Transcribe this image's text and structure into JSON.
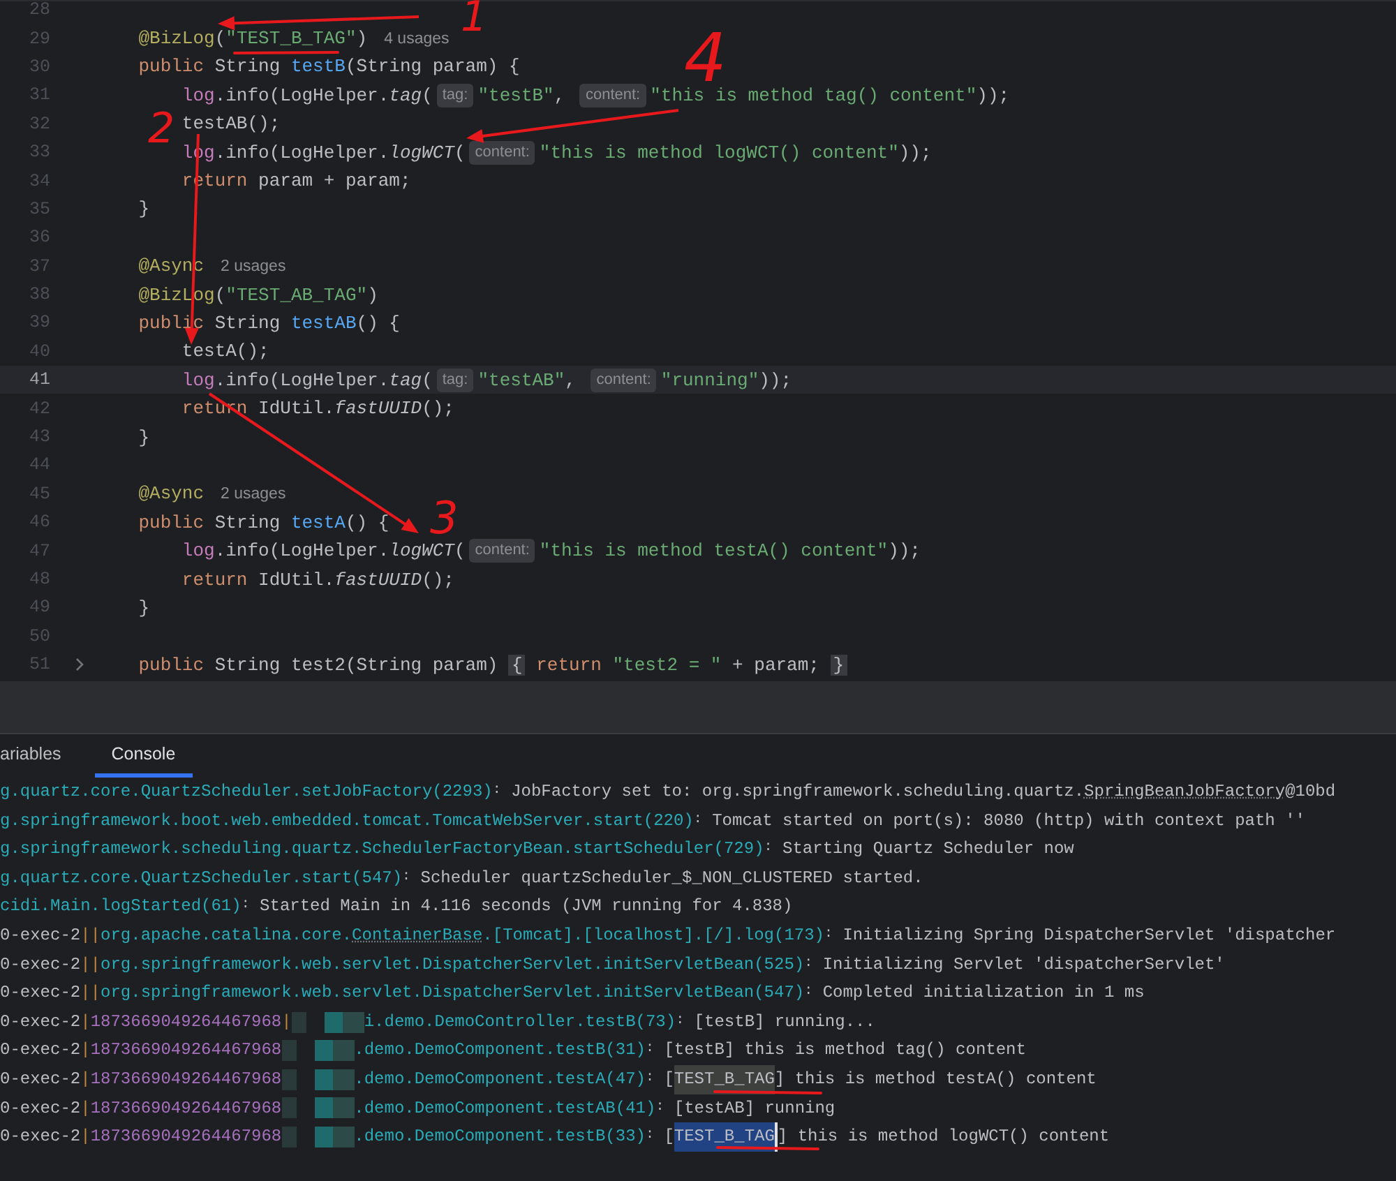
{
  "editor": {
    "lines": [
      {
        "number": "28",
        "current": false
      },
      {
        "number": "29",
        "current": false,
        "tokens": [
          {
            "kind": "ann",
            "text": "    @BizLog"
          },
          {
            "kind": "plain",
            "text": "("
          },
          {
            "kind": "str",
            "text": "\"TEST_B_TAG\""
          },
          {
            "kind": "plain",
            "text": ")"
          },
          {
            "kind": "usage",
            "text": "4 usages"
          }
        ]
      },
      {
        "number": "30",
        "current": false,
        "tokens": [
          {
            "kind": "kw",
            "text": "    public"
          },
          {
            "kind": "plain",
            "text": " String "
          },
          {
            "kind": "decl",
            "text": "testB"
          },
          {
            "kind": "plain",
            "text": "(String param) {"
          }
        ]
      },
      {
        "number": "31",
        "current": false,
        "tokens": [
          {
            "kind": "field",
            "text": "        log"
          },
          {
            "kind": "plain",
            "text": ".info(LogHelper."
          },
          {
            "kind": "ital",
            "text": "tag"
          },
          {
            "kind": "plain",
            "text": "("
          },
          {
            "kind": "hint",
            "text": "tag:"
          },
          {
            "kind": "str",
            "text": "\"testB\""
          },
          {
            "kind": "plain",
            "text": ", "
          },
          {
            "kind": "hint",
            "text": "content:"
          },
          {
            "kind": "str",
            "text": "\"this is method tag() content\""
          },
          {
            "kind": "plain",
            "text": "));"
          }
        ]
      },
      {
        "number": "32",
        "current": false,
        "tokens": [
          {
            "kind": "plain",
            "text": "        testAB();"
          }
        ]
      },
      {
        "number": "33",
        "current": false,
        "tokens": [
          {
            "kind": "field",
            "text": "        log"
          },
          {
            "kind": "plain",
            "text": ".info(LogHelper."
          },
          {
            "kind": "ital",
            "text": "logWCT"
          },
          {
            "kind": "plain",
            "text": "("
          },
          {
            "kind": "hint",
            "text": "content:"
          },
          {
            "kind": "str",
            "text": "\"this is method logWCT() content\""
          },
          {
            "kind": "plain",
            "text": "));"
          }
        ]
      },
      {
        "number": "34",
        "current": false,
        "tokens": [
          {
            "kind": "kw",
            "text": "        return"
          },
          {
            "kind": "plain",
            "text": " param + param;"
          }
        ]
      },
      {
        "number": "35",
        "current": false,
        "tokens": [
          {
            "kind": "plain",
            "text": "    }"
          }
        ]
      },
      {
        "number": "36",
        "current": false
      },
      {
        "number": "37",
        "current": false,
        "tokens": [
          {
            "kind": "ann",
            "text": "    @Async"
          },
          {
            "kind": "usage",
            "text": "2 usages"
          }
        ]
      },
      {
        "number": "38",
        "current": false,
        "tokens": [
          {
            "kind": "ann",
            "text": "    @BizLog"
          },
          {
            "kind": "plain",
            "text": "("
          },
          {
            "kind": "str",
            "text": "\"TEST_AB_TAG\""
          },
          {
            "kind": "plain",
            "text": ")"
          }
        ]
      },
      {
        "number": "39",
        "current": false,
        "tokens": [
          {
            "kind": "kw",
            "text": "    public"
          },
          {
            "kind": "plain",
            "text": " String "
          },
          {
            "kind": "decl",
            "text": "testAB"
          },
          {
            "kind": "plain",
            "text": "() {"
          }
        ]
      },
      {
        "number": "40",
        "current": false,
        "tokens": [
          {
            "kind": "plain",
            "text": "        testA();"
          }
        ]
      },
      {
        "number": "41",
        "current": true,
        "tokens": [
          {
            "kind": "field",
            "text": "        log"
          },
          {
            "kind": "plain",
            "text": ".info(LogHelper."
          },
          {
            "kind": "ital",
            "text": "tag"
          },
          {
            "kind": "plain",
            "text": "("
          },
          {
            "kind": "hint",
            "text": "tag:"
          },
          {
            "kind": "str",
            "text": "\"testAB\""
          },
          {
            "kind": "plain",
            "text": ", "
          },
          {
            "kind": "hint",
            "text": "content:"
          },
          {
            "kind": "str",
            "text": "\"running\""
          },
          {
            "kind": "plain",
            "text": "));"
          }
        ]
      },
      {
        "number": "42",
        "current": false,
        "tokens": [
          {
            "kind": "kw",
            "text": "        return"
          },
          {
            "kind": "plain",
            "text": " IdUtil."
          },
          {
            "kind": "ital",
            "text": "fastUUID"
          },
          {
            "kind": "plain",
            "text": "();"
          }
        ]
      },
      {
        "number": "43",
        "current": false,
        "tokens": [
          {
            "kind": "plain",
            "text": "    }"
          }
        ]
      },
      {
        "number": "44",
        "current": false
      },
      {
        "number": "45",
        "current": false,
        "tokens": [
          {
            "kind": "ann",
            "text": "    @Async"
          },
          {
            "kind": "usage",
            "text": "2 usages"
          }
        ]
      },
      {
        "number": "46",
        "current": false,
        "tokens": [
          {
            "kind": "kw",
            "text": "    public"
          },
          {
            "kind": "plain",
            "text": " String "
          },
          {
            "kind": "decl",
            "text": "testA"
          },
          {
            "kind": "plain",
            "text": "() {"
          }
        ]
      },
      {
        "number": "47",
        "current": false,
        "tokens": [
          {
            "kind": "field",
            "text": "        log"
          },
          {
            "kind": "plain",
            "text": ".info(LogHelper."
          },
          {
            "kind": "ital",
            "text": "logWCT"
          },
          {
            "kind": "plain",
            "text": "("
          },
          {
            "kind": "hint",
            "text": "content:"
          },
          {
            "kind": "str",
            "text": "\"this is method testA() content\""
          },
          {
            "kind": "plain",
            "text": "));"
          }
        ]
      },
      {
        "number": "48",
        "current": false,
        "tokens": [
          {
            "kind": "kw",
            "text": "        return"
          },
          {
            "kind": "plain",
            "text": " IdUtil."
          },
          {
            "kind": "ital",
            "text": "fastUUID"
          },
          {
            "kind": "plain",
            "text": "();"
          }
        ]
      },
      {
        "number": "49",
        "current": false,
        "tokens": [
          {
            "kind": "plain",
            "text": "    }"
          }
        ]
      },
      {
        "number": "50",
        "current": false
      },
      {
        "number": "51",
        "current": false,
        "tokens": [
          {
            "kind": "kw",
            "text": "    public"
          },
          {
            "kind": "plain",
            "text": " String test2(String param) "
          },
          {
            "kind": "fold",
            "text": "{"
          },
          {
            "kind": "kw",
            "text": " return "
          },
          {
            "kind": "str",
            "text": "\"test2 = \""
          },
          {
            "kind": "plain",
            "text": " + param; "
          },
          {
            "kind": "fold",
            "text": "}"
          }
        ]
      }
    ]
  },
  "tabs": [
    {
      "label": "ariables",
      "selected": false
    },
    {
      "label": "Console",
      "selected": true
    }
  ],
  "console": {
    "lines": [
      [
        {
          "kind": "class",
          "text": "g.quartz.core.QuartzScheduler.setJobFactory(2293)"
        },
        {
          "kind": "colon",
          "text": ":"
        },
        {
          "kind": "msg",
          "text": " JobFactory set to: org.springframework.scheduling.quartz."
        },
        {
          "kind": "msglink",
          "text": "SpringBeanJobFactory"
        },
        {
          "kind": "msg",
          "text": "@10bd"
        }
      ],
      [
        {
          "kind": "class",
          "text": "g.springframework.boot.web.embedded.tomcat.TomcatWebServer.start(220)"
        },
        {
          "kind": "colon",
          "text": ":"
        },
        {
          "kind": "msg",
          "text": " Tomcat started on port(s): 8080 (http) with context path ''"
        }
      ],
      [
        {
          "kind": "class",
          "text": "g.springframework.scheduling.quartz.SchedulerFactoryBean.startScheduler(729)"
        },
        {
          "kind": "colon",
          "text": ":"
        },
        {
          "kind": "msg",
          "text": " Starting Quartz Scheduler now"
        }
      ],
      [
        {
          "kind": "class",
          "text": "g.quartz.core.QuartzScheduler.start(547)"
        },
        {
          "kind": "colon",
          "text": ":"
        },
        {
          "kind": "msg",
          "text": " Scheduler quartzScheduler_$_NON_CLUSTERED started."
        }
      ],
      [
        {
          "kind": "class",
          "text": "cidi.Main.logStarted(61)"
        },
        {
          "kind": "colon",
          "text": ":"
        },
        {
          "kind": "msg",
          "text": " Started Main in 4.116 seconds (JVM running for 4.838)"
        }
      ],
      [
        {
          "kind": "thread",
          "text": "0-exec-2"
        },
        {
          "kind": "bar",
          "text": "||"
        },
        {
          "kind": "class",
          "text": "org.apache.catalina.core."
        },
        {
          "kind": "link",
          "text": "ContainerBase"
        },
        {
          "kind": "class",
          "text": ".[Tomcat].[localhost].[/].log(173)"
        },
        {
          "kind": "colon",
          "text": ":"
        },
        {
          "kind": "msg",
          "text": " Initializing Spring DispatcherServlet 'dispatcher"
        }
      ],
      [
        {
          "kind": "thread",
          "text": "0-exec-2"
        },
        {
          "kind": "bar",
          "text": "||"
        },
        {
          "kind": "class",
          "text": "org.springframework.web.servlet.DispatcherServlet.initServletBean(525)"
        },
        {
          "kind": "colon",
          "text": ":"
        },
        {
          "kind": "msg",
          "text": " Initializing Servlet 'dispatcherServlet'"
        }
      ],
      [
        {
          "kind": "thread",
          "text": "0-exec-2"
        },
        {
          "kind": "bar",
          "text": "||"
        },
        {
          "kind": "class",
          "text": "org.springframework.web.servlet.DispatcherServlet.initServletBean(547)"
        },
        {
          "kind": "colon",
          "text": ":"
        },
        {
          "kind": "msg",
          "text": " Completed initialization in 1 ms"
        }
      ],
      [
        {
          "kind": "thread",
          "text": "0-exec-2"
        },
        {
          "kind": "bar",
          "text": "|"
        },
        {
          "kind": "trace",
          "text": "1873669049264467968"
        },
        {
          "kind": "bar",
          "text": "|"
        },
        {
          "kind": "redacted"
        },
        {
          "kind": "class",
          "text": "i.demo.DemoController.testB(73)"
        },
        {
          "kind": "colon",
          "text": ":"
        },
        {
          "kind": "msg",
          "text": " [testB] running..."
        }
      ],
      [
        {
          "kind": "thread",
          "text": "0-exec-2"
        },
        {
          "kind": "bar",
          "text": "|"
        },
        {
          "kind": "trace",
          "text": "1873669049264467968"
        },
        {
          "kind": "redacted"
        },
        {
          "kind": "class",
          "text": ".demo.DemoComponent.testB(31)"
        },
        {
          "kind": "colon",
          "text": ":"
        },
        {
          "kind": "msg",
          "text": " [testB] this is method tag() content"
        }
      ],
      [
        {
          "kind": "thread",
          "text": "0-exec-2"
        },
        {
          "kind": "bar",
          "text": "|"
        },
        {
          "kind": "trace",
          "text": "1873669049264467968"
        },
        {
          "kind": "redacted"
        },
        {
          "kind": "class",
          "text": ".demo.DemoComponent.testA(47)"
        },
        {
          "kind": "colon",
          "text": ":"
        },
        {
          "kind": "msg",
          "text": " ["
        },
        {
          "kind": "hl",
          "text": "TEST_B_TAG"
        },
        {
          "kind": "msg",
          "text": "] this is method testA() content"
        }
      ],
      [
        {
          "kind": "thread",
          "text": "0-exec-2"
        },
        {
          "kind": "bar",
          "text": "|"
        },
        {
          "kind": "trace",
          "text": "1873669049264467968"
        },
        {
          "kind": "redacted"
        },
        {
          "kind": "class",
          "text": ".demo.DemoComponent.testAB(41)"
        },
        {
          "kind": "colon",
          "text": ":"
        },
        {
          "kind": "msg",
          "text": " [testAB] running"
        }
      ],
      [
        {
          "kind": "thread",
          "text": "0-exec-2"
        },
        {
          "kind": "bar",
          "text": "|"
        },
        {
          "kind": "trace",
          "text": "1873669049264467968"
        },
        {
          "kind": "redacted"
        },
        {
          "kind": "class",
          "text": ".demo.DemoComponent.testB(33)"
        },
        {
          "kind": "colon",
          "text": ":"
        },
        {
          "kind": "msg",
          "text": " ["
        },
        {
          "kind": "sel",
          "text": "TEST_B_TAG"
        },
        {
          "kind": "msg",
          "text": "] this is method logWCT() content"
        }
      ]
    ]
  },
  "annotations": {
    "numbers": [
      "1",
      "2",
      "3",
      "4"
    ]
  }
}
